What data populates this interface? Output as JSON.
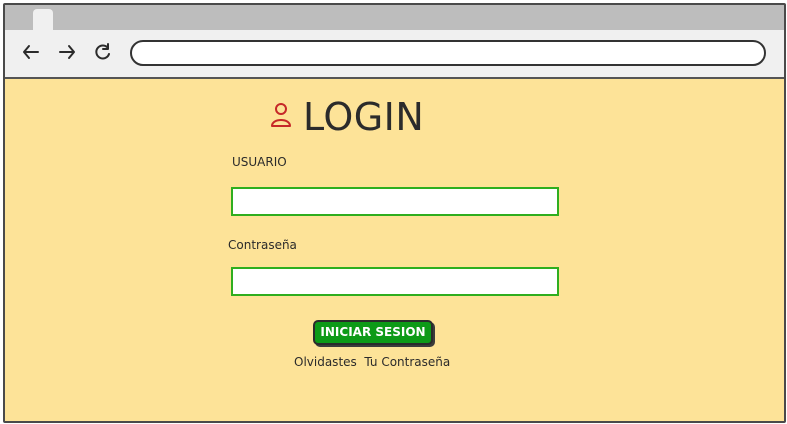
{
  "browser": {
    "back_icon": "arrow-left-icon",
    "forward_icon": "arrow-right-icon",
    "reload_icon": "reload-icon",
    "address_value": ""
  },
  "login": {
    "title": "LOGIN",
    "title_icon": "user-icon",
    "username_label": "USUARIO",
    "password_label": "Contraseña",
    "username_value": "",
    "password_value": "",
    "submit_label": "INICIAR SESION",
    "forgot_label": "Olvidastes  Tu Contraseña"
  },
  "colors": {
    "background": "#fde398",
    "accent_green": "#0d9a17",
    "field_border": "#2fae1f",
    "user_icon": "#c62828"
  }
}
